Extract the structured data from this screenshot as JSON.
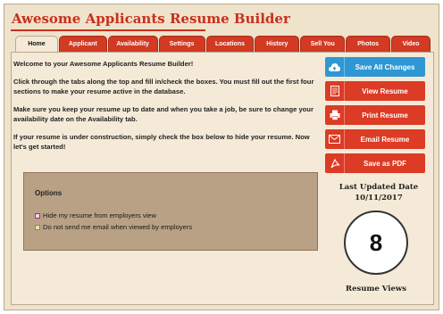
{
  "app": {
    "title": "Awesome Applicants Resume Builder"
  },
  "tabs": [
    {
      "label": "Home",
      "active": true
    },
    {
      "label": "Applicant",
      "active": false
    },
    {
      "label": "Availability",
      "active": false
    },
    {
      "label": "Settings",
      "active": false
    },
    {
      "label": "Locations",
      "active": false
    },
    {
      "label": "History",
      "active": false
    },
    {
      "label": "Sell You",
      "active": false
    },
    {
      "label": "Photos",
      "active": false
    },
    {
      "label": "Video",
      "active": false
    }
  ],
  "intro": {
    "p1": "Welcome to your Awesome Applicants Resume Builder!",
    "p2": "Click through the tabs along the top and fill in/check the boxes. You must fill out the first four sections to make your resume active in the database.",
    "p3": "Make sure you keep your resume up to date and when you take a job, be sure to change your availability date on the Availability tab.",
    "p4": "If your resume is under construction, simply check the box below to hide your resume. Now let's get started!"
  },
  "options": {
    "title": "Options",
    "hide_label": "Hide my resume from employers view",
    "email_label": "Do not send me email when viewed by employers"
  },
  "actions": {
    "save": {
      "label": "Save All Changes",
      "icon": "cloud-upload-icon"
    },
    "view": {
      "label": "View Resume",
      "icon": "document-icon"
    },
    "print": {
      "label": "Print Resume",
      "icon": "printer-icon"
    },
    "email": {
      "label": "Email Resume",
      "icon": "envelope-icon"
    },
    "pdf": {
      "label": "Save as PDF",
      "icon": "pdf-icon"
    }
  },
  "stats": {
    "updated_label": "Last Updated Date",
    "updated_date": "10/11/2017",
    "views_count": "8",
    "views_label": "Resume Views"
  },
  "colors": {
    "accent_red": "#dc3b25",
    "accent_blue": "#2e97d4",
    "title_red": "#c8301c",
    "background": "#efe3cc"
  }
}
